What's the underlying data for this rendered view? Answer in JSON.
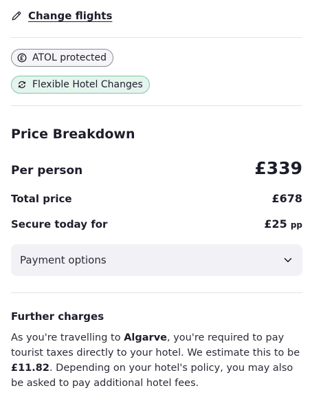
{
  "change_flights": {
    "label": "Change flights",
    "icon": "pencil-icon"
  },
  "badges": {
    "atol": {
      "label": "ATOL protected",
      "icon": "atol-icon"
    },
    "flexible": {
      "label": "Flexible Hotel Changes",
      "icon": "refresh-icon"
    }
  },
  "price_breakdown": {
    "title": "Price Breakdown",
    "per_person_label": "Per person",
    "per_person_value": "£339",
    "total_label": "Total price",
    "total_value": "£678",
    "secure_label": "Secure today for",
    "secure_value": "£25",
    "secure_suffix": "pp"
  },
  "payment_options": {
    "label": "Payment options",
    "icon": "chevron-down-icon"
  },
  "further_charges": {
    "title": "Further charges",
    "text_1": "As you're travelling to ",
    "destination": "Algarve",
    "text_2": ", you're required to pay tourist taxes directly to your hotel. We estimate this to be ",
    "amount": "£11.82",
    "text_3": ". Depending on your hotel's policy, you may also be asked to pay additional hotel fees."
  },
  "colors": {
    "text": "#1d1d2b",
    "divider": "#e3e3e8",
    "flex_badge_bg": "#e6f4ee",
    "flex_badge_border": "#7cc7a8",
    "atol_badge_border": "#8a8a96",
    "payment_bg": "#f2f1f6"
  }
}
